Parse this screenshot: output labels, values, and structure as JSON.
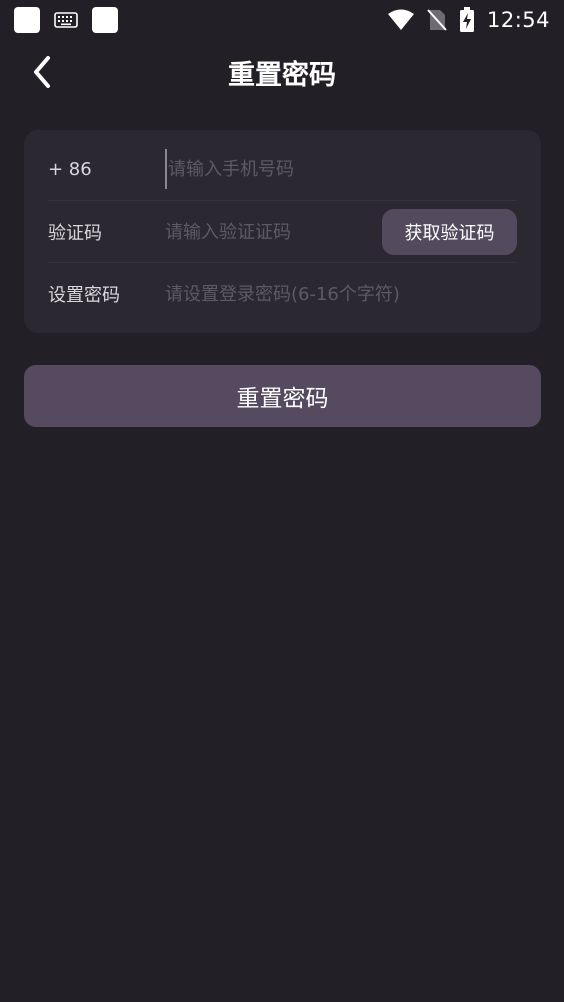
{
  "status_bar": {
    "time": "12:54",
    "icons": [
      "notification-square-icon",
      "keyboard-icon",
      "notification-square-icon",
      "wifi-icon",
      "no-sim-icon",
      "battery-charging-icon"
    ]
  },
  "header": {
    "title": "重置密码",
    "back_icon": "chevron-left-icon"
  },
  "form": {
    "phone": {
      "label": "+ 86",
      "value": "",
      "placeholder": "请输入手机号码"
    },
    "code": {
      "label": "验证码",
      "value": "",
      "placeholder": "请输入验证证码",
      "button_label": "获取验证码"
    },
    "password": {
      "label": "设置密码",
      "value": "",
      "placeholder": "请设置登录密码(6-16个字符)"
    }
  },
  "submit": {
    "label": "重置密码"
  },
  "colors": {
    "background": "#221f26",
    "card": "#2c2831",
    "button": "#554a5f",
    "code_button": "#534a5e"
  }
}
